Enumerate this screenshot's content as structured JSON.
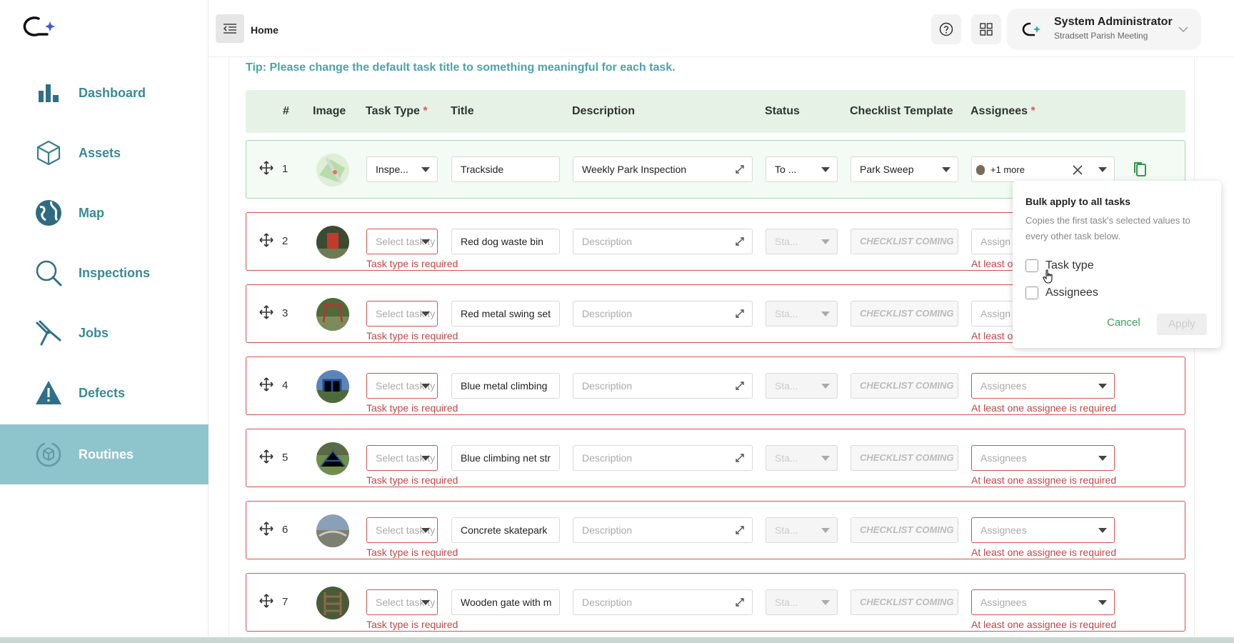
{
  "sidebar": {
    "items": [
      {
        "label": "Dashboard",
        "icon": "bar-chart-icon"
      },
      {
        "label": "Assets",
        "icon": "cube-icon"
      },
      {
        "label": "Map",
        "icon": "globe-icon"
      },
      {
        "label": "Inspections",
        "icon": "magnifier-icon"
      },
      {
        "label": "Jobs",
        "icon": "pliers-icon"
      },
      {
        "label": "Defects",
        "icon": "warning-icon"
      },
      {
        "label": "Routines",
        "icon": "routine-cycle-icon",
        "active": true
      }
    ]
  },
  "header": {
    "breadcrumb": "Home",
    "user": {
      "name": "System Administrator",
      "org": "Stradsett Parish Meeting"
    }
  },
  "tip": "Tip: Please change the default task title to something meaningful for each task.",
  "table": {
    "headers": {
      "num": "#",
      "image": "Image",
      "task_type": "Task Type",
      "title": "Title",
      "description": "Description",
      "status": "Status",
      "checklist": "Checklist Template",
      "assignees": "Assignees",
      "required_mark": "*"
    },
    "task_type_error": "Task type is required",
    "assignee_error": "At least one assignee is required",
    "assignee_error_truncated": "At least o",
    "rows": [
      {
        "num": "1",
        "task_type": "Inspe...",
        "title": "Trackside",
        "description": "Weekly Park Inspection",
        "status": "To ...",
        "checklist": "Park Sweep",
        "assignees": "+1 more"
      },
      {
        "num": "2",
        "task_type": "Select task ty",
        "title": "Red dog waste bin",
        "description": "Description",
        "status": "Sta...",
        "checklist": "CHECKLIST COMING",
        "assignees": "Assign"
      },
      {
        "num": "3",
        "task_type": "Select task ty",
        "title": "Red metal swing set",
        "description": "Description",
        "status": "Sta...",
        "checklist": "CHECKLIST COMING",
        "assignees": "Assign"
      },
      {
        "num": "4",
        "task_type": "Select task ty",
        "title": "Blue metal climbing",
        "description": "Description",
        "status": "Sta...",
        "checklist": "CHECKLIST COMING",
        "assignees": "Assignees"
      },
      {
        "num": "5",
        "task_type": "Select task ty",
        "title": "Blue climbing net str",
        "description": "Description",
        "status": "Sta...",
        "checklist": "CHECKLIST COMING",
        "assignees": "Assignees"
      },
      {
        "num": "6",
        "task_type": "Select task ty",
        "title": "Concrete skatepark",
        "description": "Description",
        "status": "Sta...",
        "checklist": "CHECKLIST COMING",
        "assignees": "Assignees"
      },
      {
        "num": "7",
        "task_type": "Select task ty",
        "title": "Wooden gate with m",
        "description": "Description",
        "status": "Sta...",
        "checklist": "CHECKLIST COMING",
        "assignees": "Assignees"
      }
    ]
  },
  "popover": {
    "title": "Bulk apply to all tasks",
    "description": "Copies the first task's selected values to every other task below.",
    "options": [
      {
        "label": "Task type",
        "checked": false
      },
      {
        "label": "Assignees",
        "checked": false
      }
    ],
    "cancel_label": "Cancel",
    "apply_label": "Apply"
  },
  "colors": {
    "accent": "#3a8a96",
    "active_nav_bg": "#8ec4cc",
    "error": "#d65050",
    "header_row_bg": "#e6f2e6",
    "tip": "#4aa3ad"
  }
}
